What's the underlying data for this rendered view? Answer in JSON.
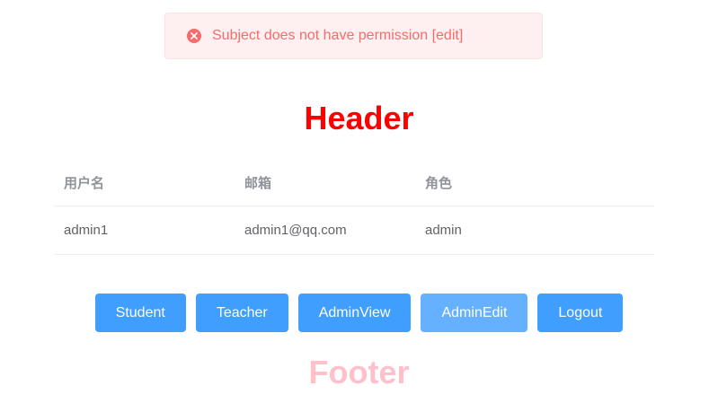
{
  "alert": {
    "message": "Subject does not have permission [edit]",
    "icon": "error-circle-icon",
    "color": "#f56c6c"
  },
  "header": {
    "title": "Header",
    "color": "#ff0000"
  },
  "table": {
    "columns": [
      "用户名",
      "邮箱",
      "角色"
    ],
    "rows": [
      [
        "admin1",
        "admin1@qq.com",
        "admin"
      ]
    ]
  },
  "nav": {
    "buttons": [
      {
        "label": "Student"
      },
      {
        "label": "Teacher"
      },
      {
        "label": "AdminView"
      },
      {
        "label": "AdminEdit",
        "state": "active"
      },
      {
        "label": "Logout"
      }
    ],
    "color": "#409eff",
    "active_color": "#66b1ff"
  },
  "footer": {
    "title": "Footer",
    "color": "#ffc0cb"
  }
}
